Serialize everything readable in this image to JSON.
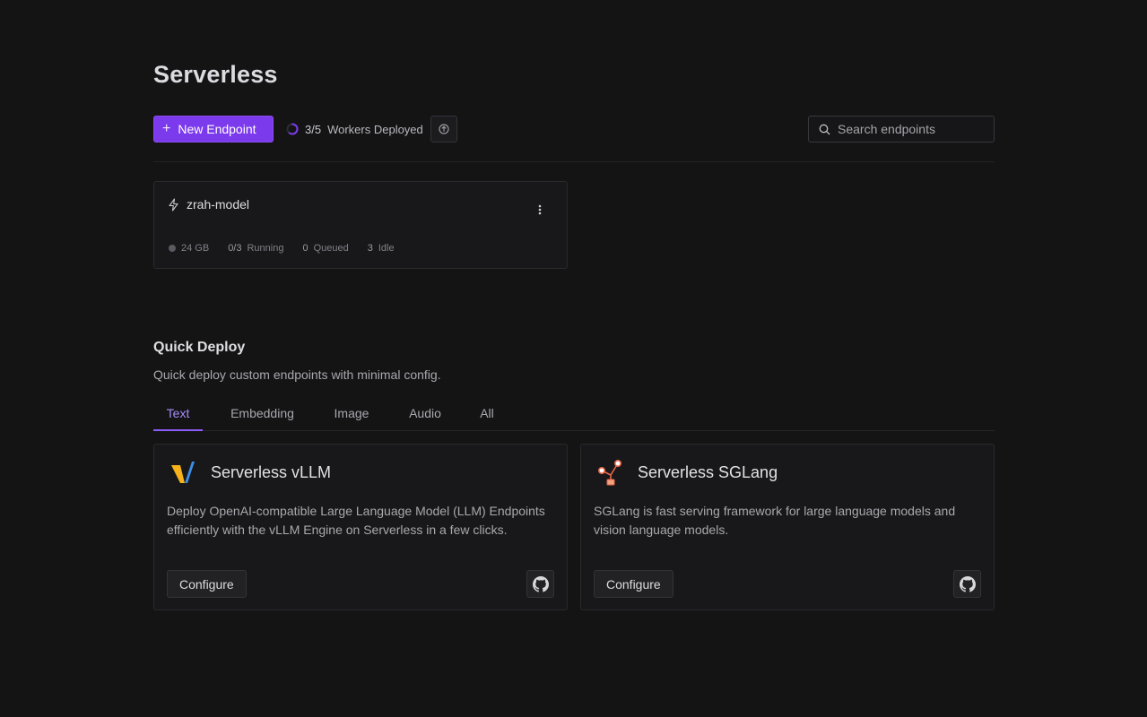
{
  "page": {
    "title": "Serverless"
  },
  "toolbar": {
    "new_endpoint_label": "New Endpoint",
    "workers_count": "3/5",
    "workers_label": "Workers Deployed",
    "workers_progress": 0.6,
    "search_placeholder": "Search endpoints"
  },
  "endpoints": [
    {
      "name": "zrah-model",
      "gpu": "24 GB",
      "running_count": "0/3",
      "running_label": "Running",
      "queued_count": "0",
      "queued_label": "Queued",
      "idle_count": "3",
      "idle_label": "Idle"
    }
  ],
  "quick_deploy": {
    "title": "Quick Deploy",
    "subtitle": "Quick deploy custom endpoints with minimal config.",
    "tabs": [
      {
        "label": "Text",
        "active": true
      },
      {
        "label": "Embedding",
        "active": false
      },
      {
        "label": "Image",
        "active": false
      },
      {
        "label": "Audio",
        "active": false
      },
      {
        "label": "All",
        "active": false
      }
    ],
    "cards": [
      {
        "title": "Serverless vLLM",
        "description": "Deploy OpenAI-compatible Large Language Model (LLM) Endpoints efficiently with the vLLM Engine on Serverless in a few clicks.",
        "configure_label": "Configure",
        "icon": "vllm-logo-icon"
      },
      {
        "title": "Serverless SGLang",
        "description": "SGLang is fast serving framework for large language models and vision language models.",
        "configure_label": "Configure",
        "icon": "sglang-logo-icon"
      }
    ]
  },
  "colors": {
    "background": "#141415",
    "accent": "#7c3aed",
    "tab_active": "#a78bfa"
  }
}
